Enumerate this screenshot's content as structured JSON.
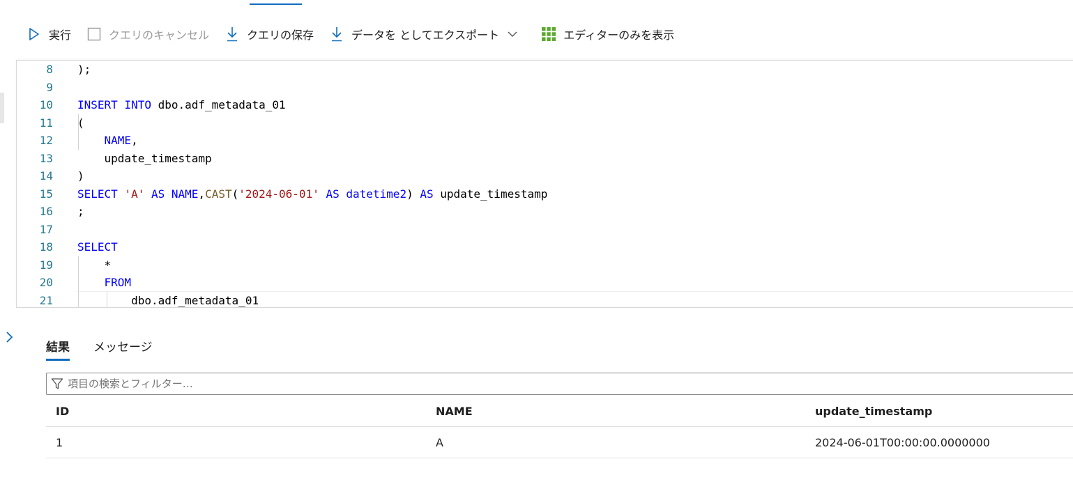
{
  "toolbar": {
    "run_label": "実行",
    "cancel_label": "クエリのキャンセル",
    "save_label": "クエリの保存",
    "export_label": "データを としてエクスポート",
    "editor_only_label": "エディターのみを表示"
  },
  "editor": {
    "lines": [
      {
        "num": "8",
        "tokens": [
          {
            "t": ");",
            "c": "plain"
          }
        ]
      },
      {
        "num": "9",
        "tokens": []
      },
      {
        "num": "10",
        "tokens": [
          {
            "t": "INSERT",
            "c": "kw"
          },
          {
            "t": " ",
            "c": "plain"
          },
          {
            "t": "INTO",
            "c": "kw"
          },
          {
            "t": " dbo.adf_metadata_01",
            "c": "plain"
          }
        ]
      },
      {
        "num": "11",
        "tokens": [
          {
            "t": "(",
            "c": "plain"
          }
        ]
      },
      {
        "num": "12",
        "tokens": [
          {
            "t": "    ",
            "c": "plain"
          },
          {
            "t": "NAME",
            "c": "kw"
          },
          {
            "t": ",",
            "c": "plain"
          }
        ]
      },
      {
        "num": "13",
        "tokens": [
          {
            "t": "    update_timestamp",
            "c": "plain"
          }
        ]
      },
      {
        "num": "14",
        "tokens": [
          {
            "t": ")",
            "c": "plain"
          }
        ]
      },
      {
        "num": "15",
        "tokens": [
          {
            "t": "SELECT",
            "c": "kw"
          },
          {
            "t": " ",
            "c": "plain"
          },
          {
            "t": "'A'",
            "c": "str"
          },
          {
            "t": " ",
            "c": "plain"
          },
          {
            "t": "AS",
            "c": "kw"
          },
          {
            "t": " ",
            "c": "plain"
          },
          {
            "t": "NAME",
            "c": "kw"
          },
          {
            "t": ",",
            "c": "plain"
          },
          {
            "t": "CAST",
            "c": "fn"
          },
          {
            "t": "(",
            "c": "plain"
          },
          {
            "t": "'2024-06-01'",
            "c": "str"
          },
          {
            "t": " ",
            "c": "plain"
          },
          {
            "t": "AS",
            "c": "kw"
          },
          {
            "t": " ",
            "c": "plain"
          },
          {
            "t": "datetime2",
            "c": "kw"
          },
          {
            "t": ") ",
            "c": "plain"
          },
          {
            "t": "AS",
            "c": "kw"
          },
          {
            "t": " update_timestamp",
            "c": "plain"
          }
        ]
      },
      {
        "num": "16",
        "tokens": [
          {
            "t": ";",
            "c": "plain"
          }
        ]
      },
      {
        "num": "17",
        "tokens": []
      },
      {
        "num": "18",
        "tokens": [
          {
            "t": "SELECT",
            "c": "kw"
          }
        ]
      },
      {
        "num": "19",
        "tokens": [
          {
            "t": "    *",
            "c": "plain"
          }
        ]
      },
      {
        "num": "20",
        "tokens": [
          {
            "t": "    ",
            "c": "plain"
          },
          {
            "t": "FROM",
            "c": "kw"
          }
        ]
      },
      {
        "num": "21",
        "tokens": [
          {
            "t": "        dbo.adf_metadata_01",
            "c": "plain"
          }
        ]
      }
    ]
  },
  "results": {
    "tabs": [
      {
        "label": "結果",
        "active": true
      },
      {
        "label": "メッセージ",
        "active": false
      }
    ],
    "filter_placeholder": "項目の検索とフィルター…",
    "columns": [
      "ID",
      "NAME",
      "update_timestamp"
    ],
    "rows": [
      [
        "1",
        "A",
        "2024-06-01T00:00:00.0000000"
      ]
    ]
  },
  "colors": {
    "accent": "#0f6cbd",
    "keyword": "#0000ff",
    "string": "#a31515",
    "line_number": "#237893",
    "grid_icon": "#5ea832"
  }
}
